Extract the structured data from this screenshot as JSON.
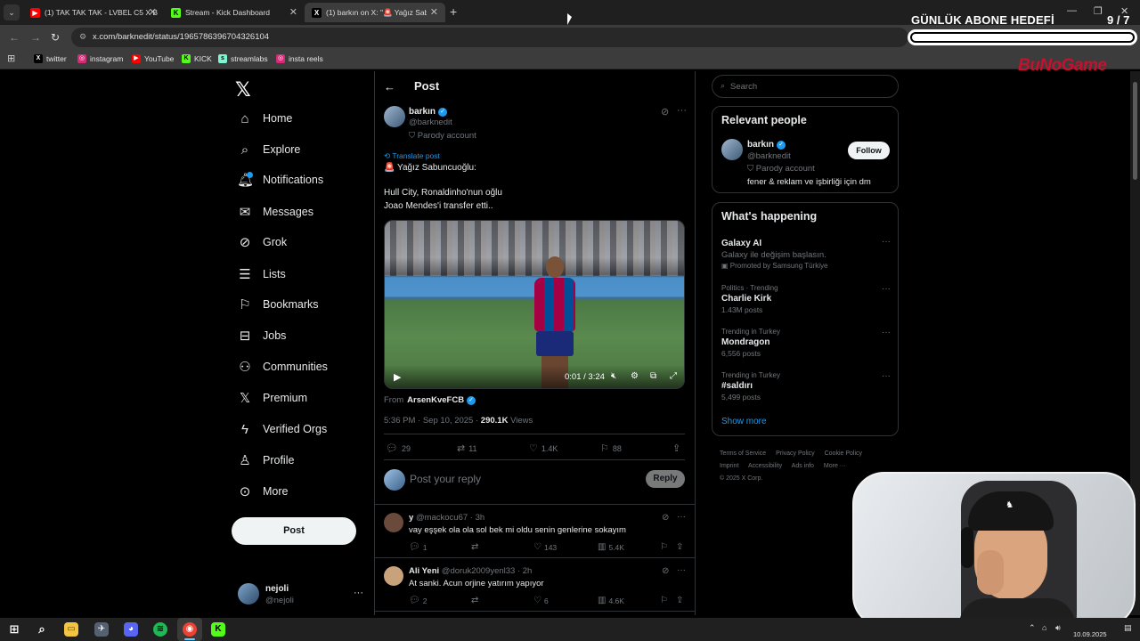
{
  "browser": {
    "tabs": [
      {
        "label": "(1) TAK TAK TAK - LVBEL C5 X B",
        "icon": "youtube-icon",
        "color": "#ff0000"
      },
      {
        "label": "Stream - Kick Dashboard",
        "icon": "kick-icon",
        "color": "#53fc18"
      },
      {
        "label": "(1) barkın on X: \"🚨 Yağız Sabu",
        "icon": "x-icon",
        "color": "#ffffff"
      }
    ],
    "url": "x.com/barknedit/status/1965786396704326104",
    "bookmarks": [
      {
        "label": "twitter",
        "icon": "x-icon"
      },
      {
        "label": "instagram",
        "icon": "instagram-icon"
      },
      {
        "label": "YouTube",
        "icon": "youtube-icon"
      },
      {
        "label": "KICK",
        "icon": "kick-icon"
      },
      {
        "label": "streamlabs",
        "icon": "streamlabs-icon"
      },
      {
        "label": "insta reels",
        "icon": "instagram-icon"
      }
    ]
  },
  "overlay": {
    "goal_title": "GÜNLÜK ABONE HEDEFİ",
    "goal_count": "9 / 7",
    "goal_progress": 1.0,
    "brand": "BuNoGame"
  },
  "nav": {
    "items": [
      {
        "label": "Home",
        "icon": "home-icon"
      },
      {
        "label": "Explore",
        "icon": "search-icon"
      },
      {
        "label": "Notifications",
        "icon": "bell-icon"
      },
      {
        "label": "Messages",
        "icon": "mail-icon"
      },
      {
        "label": "Grok",
        "icon": "grok-icon"
      },
      {
        "label": "Lists",
        "icon": "list-icon"
      },
      {
        "label": "Bookmarks",
        "icon": "bookmark-icon"
      },
      {
        "label": "Jobs",
        "icon": "briefcase-icon"
      },
      {
        "label": "Communities",
        "icon": "people-icon"
      },
      {
        "label": "Premium",
        "icon": "x-icon"
      },
      {
        "label": "Verified Orgs",
        "icon": "lightning-icon"
      },
      {
        "label": "Profile",
        "icon": "person-icon"
      },
      {
        "label": "More",
        "icon": "more-circle-icon"
      }
    ],
    "post_label": "Post",
    "me": {
      "name": "nejoli",
      "handle": "@nejoli"
    }
  },
  "post": {
    "header_title": "Post",
    "author": {
      "name": "barkın",
      "handle": "@barknedit",
      "label": "Parody account"
    },
    "translate_label": "Translate post",
    "text_lines": [
      "🚨 Yağız Sabuncuoğlu:",
      "",
      "Hull City, Ronaldinho'nun oğlu",
      "Joao Mendes'i transfer etti.."
    ],
    "video": {
      "time": "0:01 / 3:24"
    },
    "from_label": "From",
    "from_account": "ArsenKveFCB",
    "timestamp": "5:36 PM · Sep 10, 2025 · ",
    "views_count": "290.1K",
    "views_label": " Views",
    "stats": {
      "replies": "29",
      "reposts": "11",
      "likes": "1.4K",
      "bookmarks": "88"
    },
    "reply_placeholder": "Post your reply",
    "reply_button": "Reply"
  },
  "comments": [
    {
      "name": "y",
      "handle": "@mackocu67 · 3h",
      "text": "vay eşşek ola ola sol bek mi oldu senin genlerine sokayım",
      "replies": "1",
      "likes": "143",
      "views": "5.4K",
      "avatar": "#6a4a3a"
    },
    {
      "name": "Ali Yeni",
      "handle": "@doruk2009yenl33 · 2h",
      "text": "At sanki. Acun orjine yatırım yapıyor",
      "replies": "2",
      "likes": "6",
      "views": "4.6K",
      "avatar": "#c8a27a"
    }
  ],
  "sidebar": {
    "search_placeholder": "Search",
    "relevant_title": "Relevant people",
    "relevant": {
      "name": "barkın",
      "handle": "@barknedit",
      "label": "Parody account",
      "bio": "fener & reklam ve işbirliği için dm",
      "follow": "Follow"
    },
    "happening_title": "What's happening",
    "trends": [
      {
        "category": "",
        "name": "Galaxy AI",
        "posts": "Galaxy ile değişim başlasın.",
        "promo": "Promoted by Samsung Türkiye"
      },
      {
        "category": "Politics · Trending",
        "name": "Charlie Kirk",
        "posts": "1.43M posts",
        "promo": ""
      },
      {
        "category": "Trending in Turkey",
        "name": "Mondragon",
        "posts": "6,556 posts",
        "promo": ""
      },
      {
        "category": "Trending in Turkey",
        "name": "#saldırı",
        "posts": "5,499 posts",
        "promo": ""
      }
    ],
    "show_more": "Show more",
    "footer": [
      "Terms of Service",
      "Privacy Policy",
      "Cookie Policy",
      "Imprint",
      "Accessibility",
      "Ads info",
      "More ···",
      "© 2025 X Corp."
    ]
  },
  "taskbar": {
    "clock_date": "10.09.2025"
  }
}
